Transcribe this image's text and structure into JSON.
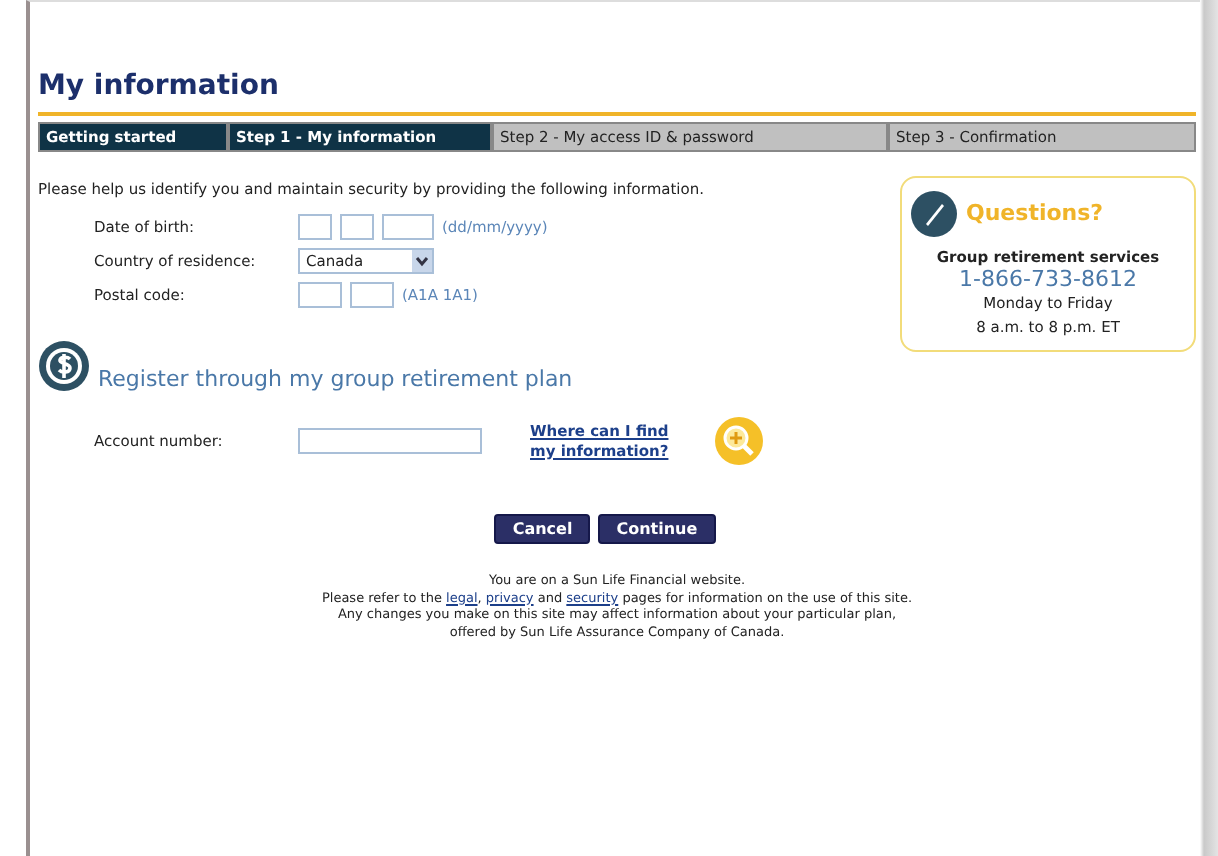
{
  "page_title": "My information",
  "steps": [
    {
      "label": "Getting started",
      "highlighted": true
    },
    {
      "label": "Step 1 - My information",
      "highlighted": true
    },
    {
      "label": "Step 2 - My access ID & password",
      "highlighted": false
    },
    {
      "label": "Step 3 - Confirmation",
      "highlighted": false
    }
  ],
  "intro": "Please help us identify you and maintain security by providing the following information.",
  "fields": [
    {
      "label": "Date of birth:",
      "kind": "date",
      "hint": "(dd/mm/yyyy)"
    },
    {
      "label": "Country of residence:",
      "kind": "select",
      "value": "Canada"
    },
    {
      "label": "Postal code:",
      "kind": "postal",
      "hint": "(A1A 1A1)"
    }
  ],
  "section_title": "Register through my group retirement plan",
  "account": {
    "label": "Account number:",
    "help_link": "Where can I find my information?"
  },
  "buttons": [
    "Cancel",
    "Continue"
  ],
  "questions": {
    "title": "Questions?",
    "service": "Group retirement services",
    "phone": "1-866-733-8612",
    "days": "Monday to Friday",
    "hours": "8 a.m. to 8 p.m. ET"
  },
  "footer": [
    [
      {
        "kind": "text",
        "text": "You are on a Sun Life Financial website."
      }
    ],
    [
      {
        "kind": "text",
        "text": "Please refer to the"
      },
      {
        "kind": "link",
        "text": "legal"
      },
      {
        "kind": "text",
        "text": ","
      },
      {
        "kind": "link",
        "text": "privacy"
      },
      {
        "kind": "text",
        "text": "and"
      },
      {
        "kind": "link",
        "text": "security"
      },
      {
        "kind": "text",
        "text": "pages for information on the use of this site."
      }
    ],
    [
      {
        "kind": "text",
        "text": "Any changes you make on this site may affect information about your particular plan,"
      }
    ],
    [
      {
        "kind": "text",
        "text": "offered by Sun Life Assurance Company of Canada."
      }
    ]
  ]
}
